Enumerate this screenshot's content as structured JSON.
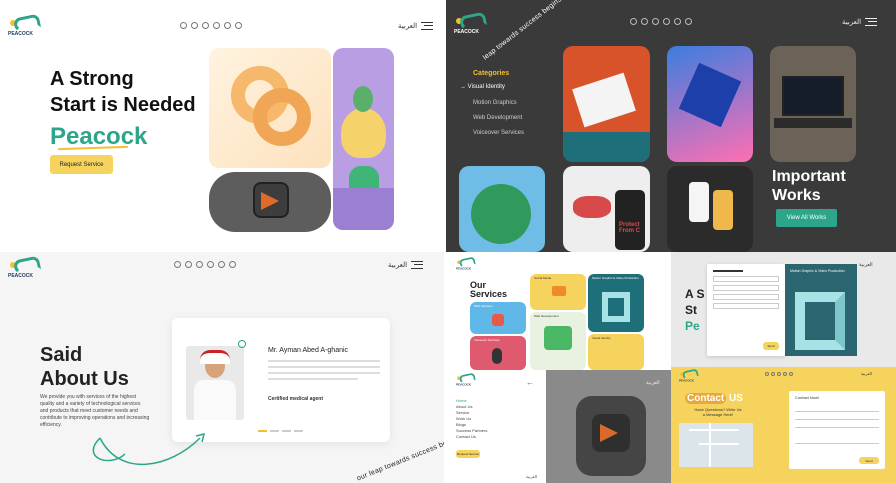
{
  "logo": {
    "text": "PEACOCK"
  },
  "lang": "العربية",
  "social": [
    "whatsapp-icon",
    "x-icon",
    "telegram-icon",
    "instagram-icon",
    "behance-icon",
    "dribbble-icon"
  ],
  "hero": {
    "line1": "A Strong",
    "line2a": "Start",
    "line2b": "is Needed",
    "brand": "Peacock",
    "button": "Request Service"
  },
  "works": {
    "tagline": "leap towards success begins with us",
    "categories_title": "Categories",
    "categories": [
      "Visual Identity",
      "Motion Graphics",
      "Web Development",
      "Voiceover Services"
    ],
    "important": "Important",
    "works_word": "Works",
    "button": "View All Works",
    "card_text": "Protect From C"
  },
  "about": {
    "title1": "Said",
    "title2": "About Us",
    "desc": "We provide you with services of the highest quality and a variety of technological services and products that meet customer needs and contribute to improving operations and increasing efficiency.",
    "name": "Mr. Ayman Abed A-ghanic",
    "role": "Certified medical agent",
    "tagline": "our leap towards success be"
  },
  "services": {
    "title1": "Our",
    "title2": "Services",
    "cards": [
      "Social Media",
      "Motion Graphic & Video Production",
      "Web Services",
      "Web Development",
      "Voiceover Services",
      "Visual Identity"
    ]
  },
  "menu_panel": {
    "items": [
      "Home",
      "About Us",
      "Service",
      "Work Us",
      "Blogs",
      "Success Partners",
      "Contact Us"
    ],
    "button": "Request Service",
    "lang": "العربية"
  },
  "form_panel": {
    "title": "Motion Graphic & Video Production",
    "button": "Send"
  },
  "contact": {
    "title_a": "Contact",
    "title_b": "US",
    "sub": "Have Questions? Write Us a Message Here!",
    "form_title": "Contact Now!",
    "button": "Send"
  },
  "colors": {
    "brand_green": "#2ca58a",
    "brand_yellow": "#f6d35c",
    "dark_bg": "#3a3a3a"
  }
}
